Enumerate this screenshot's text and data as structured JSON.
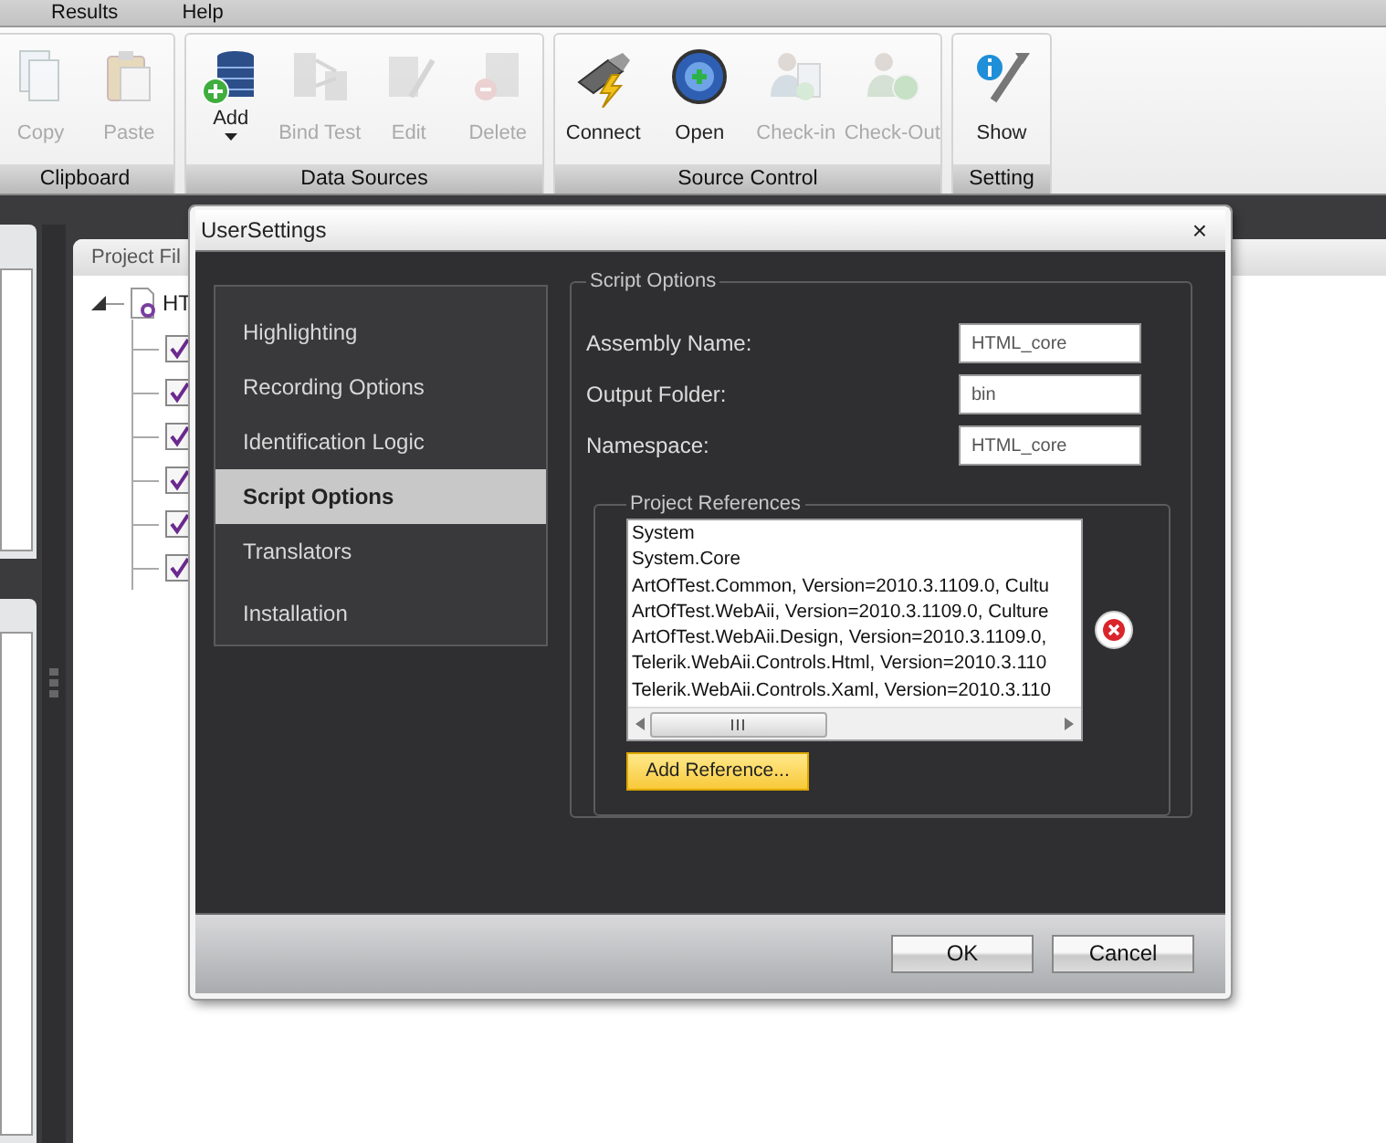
{
  "menu": [
    {
      "label": "Results"
    },
    {
      "label": "Help"
    }
  ],
  "ribbon": {
    "groups": [
      {
        "label": "Clipboard",
        "buttons": [
          {
            "label": "Copy",
            "kind": "copy",
            "disabled": true
          },
          {
            "label": "Paste",
            "kind": "paste",
            "disabled": true
          }
        ]
      },
      {
        "label": "Data Sources",
        "buttons": [
          {
            "label": "Add",
            "kind": "db-add",
            "disabled": false,
            "dropdown": true
          },
          {
            "label": "Bind Test",
            "kind": "db-bind",
            "disabled": true
          },
          {
            "label": "Edit",
            "kind": "db-edit",
            "disabled": true
          },
          {
            "label": "Delete",
            "kind": "db-delete",
            "disabled": true
          }
        ]
      },
      {
        "label": "Source Control",
        "buttons": [
          {
            "label": "Connect",
            "kind": "plug",
            "disabled": false
          },
          {
            "label": "Open",
            "kind": "globe",
            "disabled": false
          },
          {
            "label": "Check-in",
            "kind": "user-in",
            "disabled": true
          },
          {
            "label": "Check-Out",
            "kind": "user-out",
            "disabled": true
          }
        ]
      },
      {
        "label": "Setting",
        "buttons": [
          {
            "label": "Show",
            "kind": "info-wrench",
            "disabled": false
          }
        ]
      }
    ]
  },
  "project_panel": {
    "title": "Project Fil",
    "tree": [
      {
        "label": "HT",
        "expanded": true,
        "children": [
          {
            "checked": true
          },
          {
            "checked": true
          },
          {
            "checked": true
          },
          {
            "checked": true
          },
          {
            "checked": true
          },
          {
            "checked": true
          }
        ]
      }
    ]
  },
  "dialog": {
    "title": "UserSettings",
    "close": "×",
    "nav": [
      {
        "label": "Highlighting",
        "selected": false
      },
      {
        "label": "Recording Options",
        "selected": false
      },
      {
        "label": "Identification Logic",
        "selected": false
      },
      {
        "label": "Script Options",
        "selected": true
      },
      {
        "label": "Translators",
        "selected": false
      },
      {
        "label": "Installation",
        "selected": false
      }
    ],
    "script_options": {
      "title": "Script Options",
      "fields": [
        {
          "label": "Assembly Name:",
          "value": "HTML_core"
        },
        {
          "label": "Output Folder:",
          "value": "bin"
        },
        {
          "label": "Namespace:",
          "value": "HTML_core"
        }
      ],
      "references": {
        "title": "Project References",
        "items": [
          "System",
          "System.Core",
          "ArtOfTest.Common, Version=2010.3.1109.0, Cultu",
          "ArtOfTest.WebAii, Version=2010.3.1109.0, Culture",
          "ArtOfTest.WebAii.Design, Version=2010.3.1109.0,",
          "Telerik.WebAii.Controls.Html, Version=2010.3.110",
          "Telerik.WebAii.Controls.Xaml, Version=2010.3.110"
        ],
        "add_button": "Add Reference..."
      }
    },
    "buttons": [
      "OK",
      "Cancel"
    ]
  }
}
